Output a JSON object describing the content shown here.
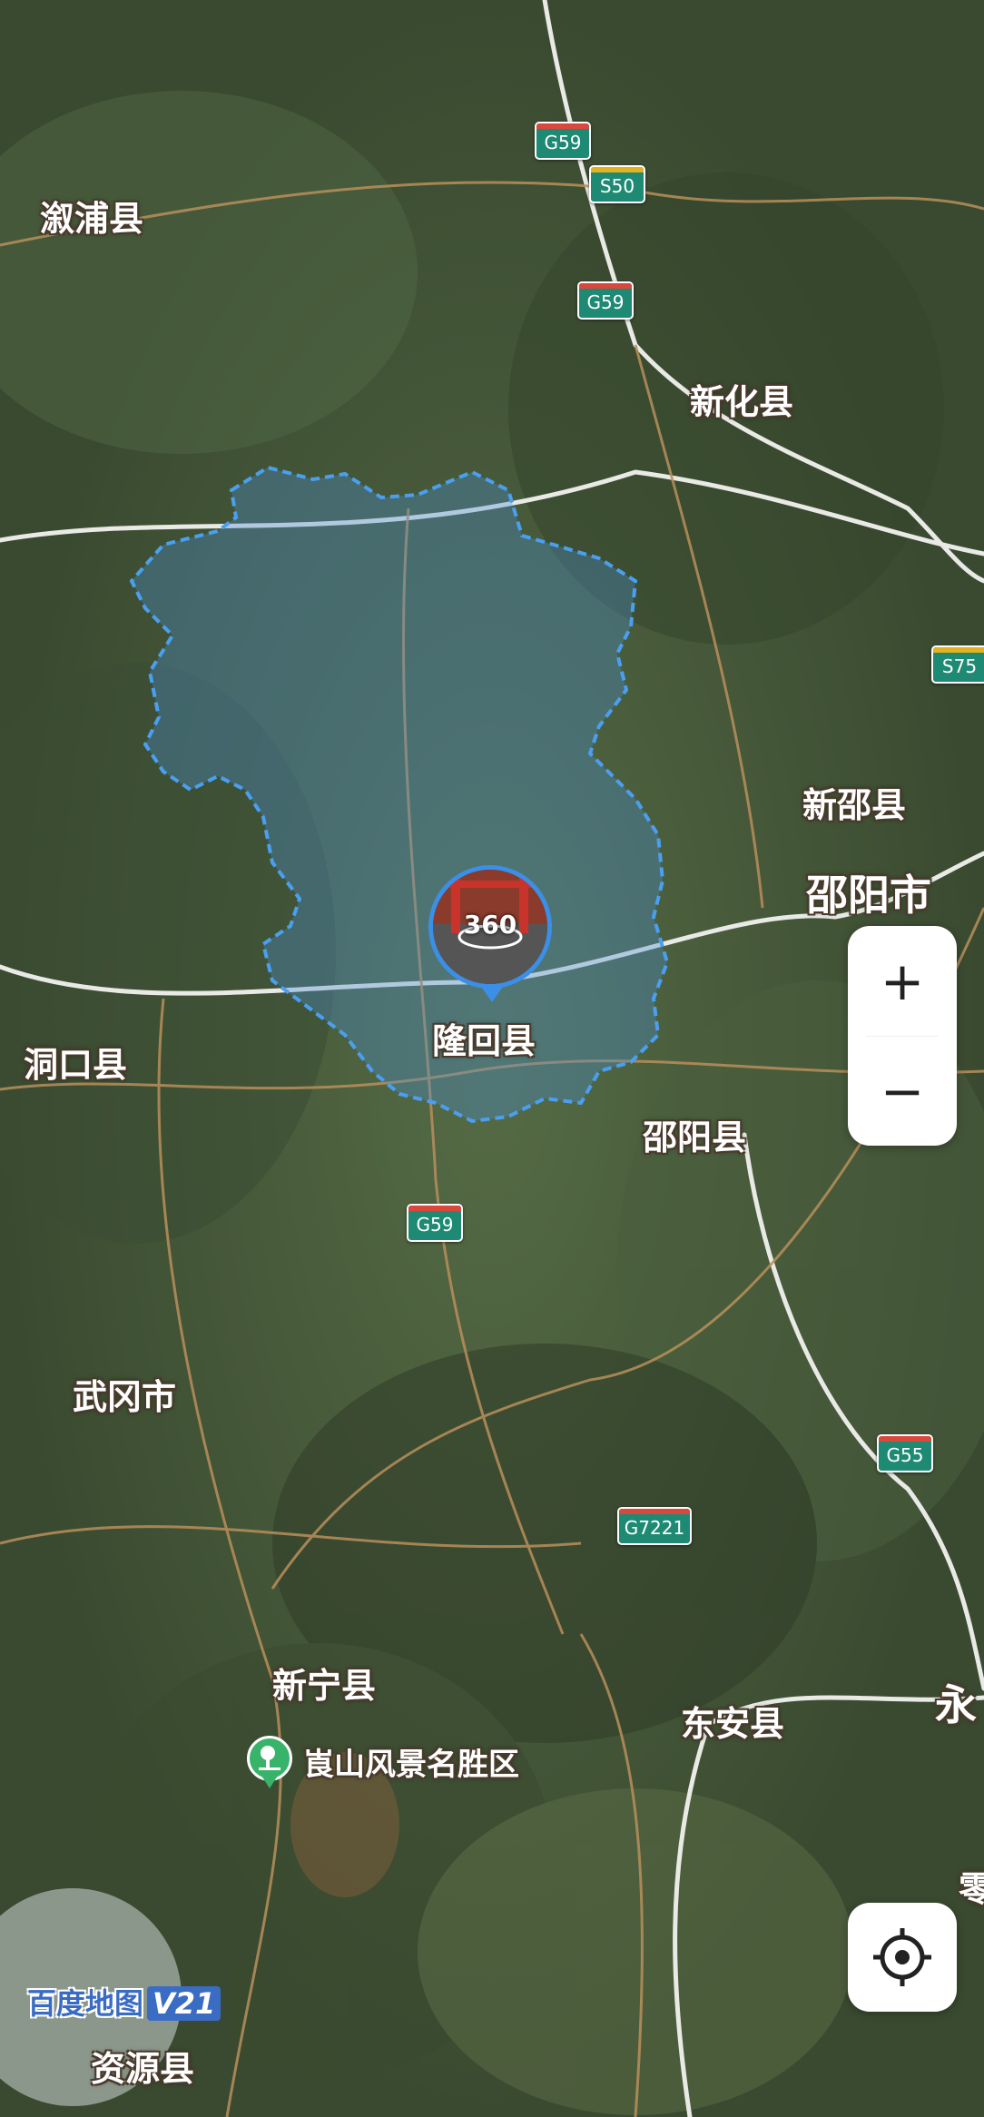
{
  "map": {
    "highlight_color": "#3b8fe6",
    "terrain_color": "#4a5a3e",
    "places": {
      "xupu": "溆浦县",
      "xinhua": "新化县",
      "xinshao": "新邵县",
      "shaoyang_city": "邵阳市",
      "longhui": "隆回县",
      "dongkou": "洞口县",
      "shaoyang_county": "邵阳县",
      "wugang": "武冈市",
      "xinning": "新宁县",
      "dongan": "东安县",
      "yong": "永",
      "ling": "零",
      "ziyuan": "资源县"
    },
    "scenic": {
      "label": "崀山风景名胜区",
      "icon": "scenic-area-icon"
    },
    "roads": {
      "g59_a": "G59",
      "s50": "S50",
      "g59_b": "G59",
      "s75": "S75",
      "g59_c": "G59",
      "g55": "G55",
      "g7221": "G7221"
    },
    "pin": {
      "badge": "360",
      "icon": "panorama-360-icon"
    }
  },
  "controls": {
    "zoom_in": "+",
    "zoom_out": "−",
    "locate_icon": "locate-crosshair-icon"
  },
  "branding": {
    "logo_text": "百度地图",
    "version": "V21"
  }
}
